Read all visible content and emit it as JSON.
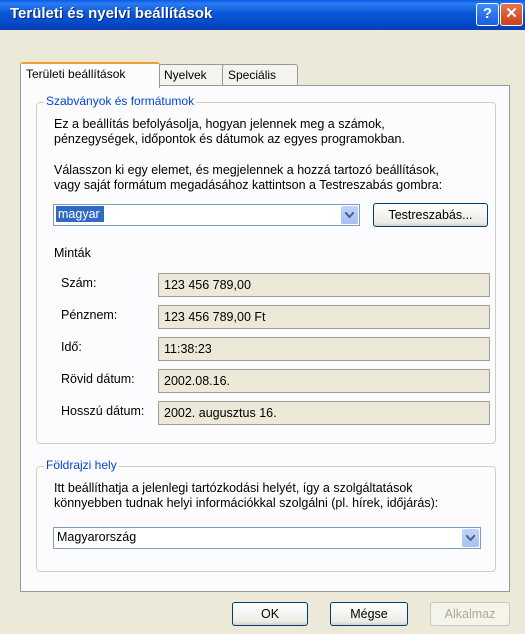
{
  "window": {
    "title": "Területi és nyelvi beállítások",
    "help_glyph": "?",
    "close_glyph": "✕"
  },
  "tabs": [
    "Területi beállítások",
    "Nyelvek",
    "Speciális"
  ],
  "standards": {
    "legend": "Szabványok és formátumok",
    "desc1": "Ez a beállítás befolyásolja, hogyan jelennek meg a számok,",
    "desc2": "pénzegységek, időpontok és dátumok az egyes programokban.",
    "desc3": "Válasszon ki egy elemet, és megjelennek a hozzá tartozó beállítások,",
    "desc4": "vagy saját formátum megadásához kattintson a Testreszabás gombra:",
    "selected": "magyar",
    "customize_label": "Testreszabás..."
  },
  "samples": {
    "heading": "Minták",
    "rows": [
      {
        "label": "Szám:",
        "value": "123 456 789,00"
      },
      {
        "label": "Pénznem:",
        "value": "123 456 789,00 Ft"
      },
      {
        "label": "Idő:",
        "value": "11:38:23"
      },
      {
        "label": "Rövid dátum:",
        "value": "2002.08.16."
      },
      {
        "label": "Hosszú dátum:",
        "value": "2002. augusztus 16."
      }
    ]
  },
  "location": {
    "legend": "Földrajzi hely",
    "desc1": "Itt beállíthatja a jelenlegi tartózkodási helyét, így a szolgáltatások",
    "desc2": "könnyebben tudnak helyi információkkal szolgálni (pl. hírek, időjárás):",
    "selected": "Magyarország"
  },
  "buttons": {
    "ok": "OK",
    "cancel": "Mégse",
    "apply": "Alkalmaz"
  }
}
